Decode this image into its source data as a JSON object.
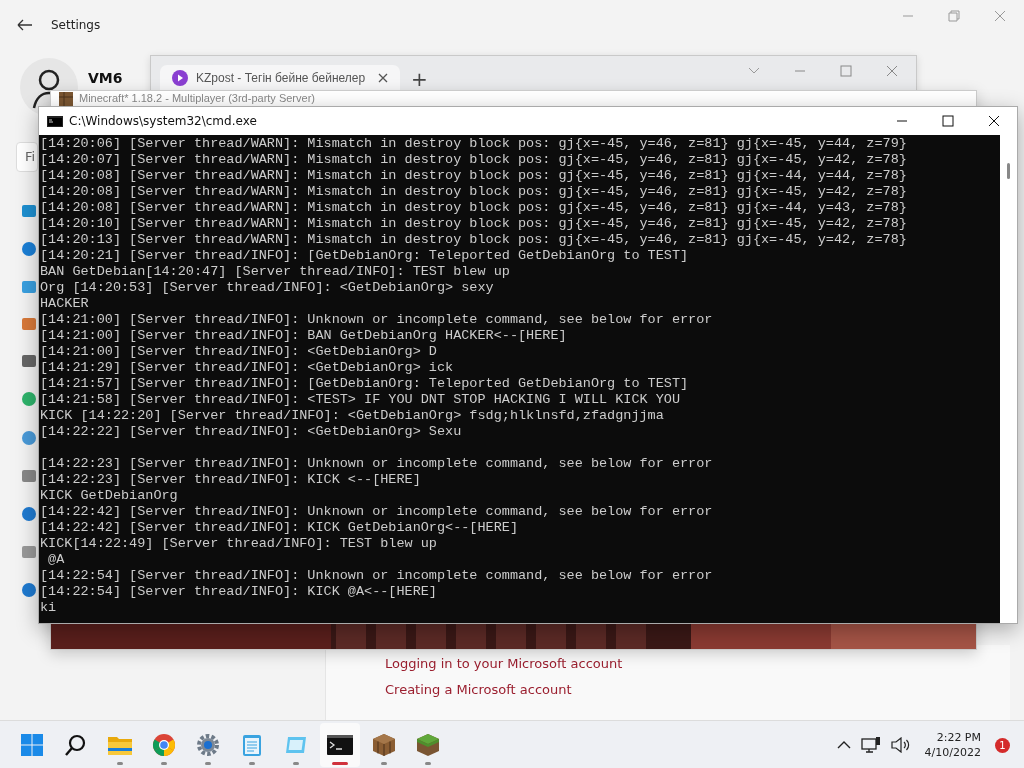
{
  "settings": {
    "title": "Settings",
    "user": "VM6",
    "search": {
      "placeholder": "Fi"
    },
    "links": [
      "Logging in to your Microsoft account",
      "Creating a Microsoft account"
    ]
  },
  "browser": {
    "tab": "KZpost - Тегін бейне бейнелер",
    "new_tab": "+"
  },
  "minecraft": {
    "title": "Minecraft* 1.18.2 - Multiplayer (3rd-party Server)"
  },
  "cmd": {
    "title": "C:\\Windows\\system32\\cmd.exe",
    "blocks": [
      [
        "[14:20:06] [Server thread/WARN]: Mismatch in destroy block pos: gj{x=-45, y=46, z=81} gj{x=-45, y=44, z=79}",
        "[14:20:07] [Server thread/WARN]: Mismatch in destroy block pos: gj{x=-45, y=46, z=81} gj{x=-45, y=42, z=78}",
        "[14:20:08] [Server thread/WARN]: Mismatch in destroy block pos: gj{x=-45, y=46, z=81} gj{x=-44, y=44, z=78}",
        "[14:20:08] [Server thread/WARN]: Mismatch in destroy block pos: gj{x=-45, y=46, z=81} gj{x=-45, y=42, z=78}",
        "[14:20:08] [Server thread/WARN]: Mismatch in destroy block pos: gj{x=-45, y=46, z=81} gj{x=-44, y=43, z=78}",
        "[14:20:10] [Server thread/WARN]: Mismatch in destroy block pos: gj{x=-45, y=46, z=81} gj{x=-45, y=42, z=78}",
        "[14:20:13] [Server thread/WARN]: Mismatch in destroy block pos: gj{x=-45, y=46, z=81} gj{x=-45, y=42, z=78}",
        "[14:20:21] [Server thread/INFO]: [GetDebianOrg: Teleported GetDebianOrg to TEST]",
        "BAN GetDebian[14:20:47] [Server thread/INFO]: TEST blew up",
        "Org [14:20:53] [Server thread/INFO]: <GetDebianOrg> sexy",
        "HACKER",
        "[14:21:00] [Server thread/INFO]: Unknown or incomplete command, see below for error",
        "[14:21:00] [Server thread/INFO]: BAN GetDebianOrg HACKER<--[HERE]",
        "[14:21:00] [Server thread/INFO]: <GetDebianOrg> D",
        "[14:21:29] [Server thread/INFO]: <GetDebianOrg> ick",
        "[14:21:57] [Server thread/INFO]: [GetDebianOrg: Teleported GetDebianOrg to TEST]",
        "[14:21:58] [Server thread/INFO]: <TEST> IF YOU DNT STOP HACKING I WILL KICK YOU",
        "KICK [14:22:20] [Server thread/INFO]: <GetDebianOrg> fsdg;hlklnsfd,zfadgnjjma",
        "[14:22:22] [Server thread/INFO]: <GetDebianOrg> Sexu"
      ],
      [
        "[14:22:23] [Server thread/INFO]: Unknown or incomplete command, see below for error",
        "[14:22:23] [Server thread/INFO]: KICK <--[HERE]",
        "KICK GetDebianOrg",
        "[14:22:42] [Server thread/INFO]: Unknown or incomplete command, see below for error",
        "[14:22:42] [Server thread/INFO]: KICK GetDebianOrg<--[HERE]",
        "KICK[14:22:49] [Server thread/INFO]: TEST blew up",
        " @A",
        "[14:22:54] [Server thread/INFO]: Unknown or incomplete command, see below for error",
        "[14:22:54] [Server thread/INFO]: KICK @A<--[HERE]",
        "ki"
      ]
    ]
  },
  "taskbar": {
    "apps": [
      {
        "kind": "start",
        "active": false
      },
      {
        "kind": "search",
        "active": false
      },
      {
        "kind": "folder",
        "active": false
      },
      {
        "kind": "chrome",
        "active": false
      },
      {
        "kind": "gear",
        "active": false
      },
      {
        "kind": "notepad",
        "active": false
      },
      {
        "kind": "tablet",
        "active": false
      },
      {
        "kind": "terminal",
        "active": true
      },
      {
        "kind": "crate",
        "active": false
      },
      {
        "kind": "grass",
        "active": false
      }
    ],
    "time": "2:22 PM",
    "date": "4/10/2022",
    "notifications": "1"
  }
}
